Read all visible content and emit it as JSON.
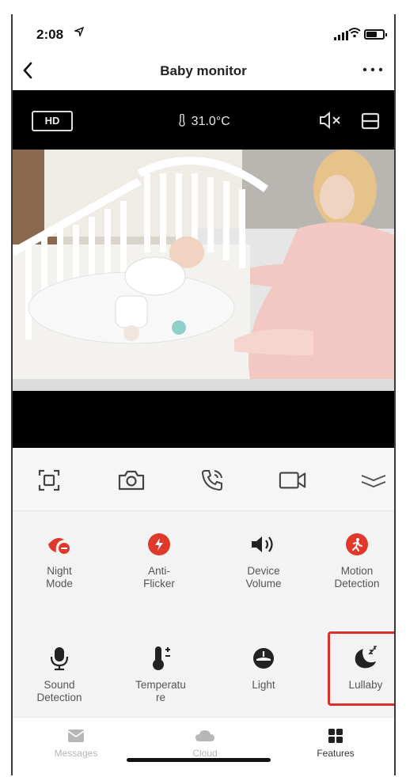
{
  "status_bar": {
    "time": "2:08",
    "location_icon": "location-arrow-icon",
    "signal_icon": "cellular-signal-icon",
    "wifi_icon": "wifi-icon",
    "battery_icon": "battery-icon"
  },
  "nav": {
    "back_icon": "chevron-left-icon",
    "title": "Baby monitor",
    "more_icon": "more-horizontal-icon"
  },
  "video": {
    "quality_label": "HD",
    "temperature": "31.0°C",
    "temperature_icon": "thermometer-icon",
    "mute_icon": "speaker-muted-icon",
    "layout_icon": "layout-icon"
  },
  "toolbar": [
    {
      "name": "screen-fit-icon"
    },
    {
      "name": "snapshot-camera-icon"
    },
    {
      "name": "call-icon"
    },
    {
      "name": "record-video-icon"
    },
    {
      "name": "collapse-chevron-icon"
    }
  ],
  "features": [
    {
      "label_lines": [
        "Night",
        "Mode"
      ],
      "icon": "night-mode-icon",
      "accent": "#e0392b"
    },
    {
      "label_lines": [
        "Anti-",
        "Flicker"
      ],
      "icon": "anti-flicker-icon",
      "accent": "#e0392b"
    },
    {
      "label_lines": [
        "Device",
        "Volume"
      ],
      "icon": "device-volume-icon",
      "accent": "#222222"
    },
    {
      "label_lines": [
        "Motion",
        "Detection"
      ],
      "icon": "motion-detection-icon",
      "accent": "#e0392b"
    },
    {
      "label_lines": [
        "Sound",
        "Detection"
      ],
      "icon": "sound-detection-icon",
      "accent": "#222222"
    },
    {
      "label_lines": [
        "Temperatu",
        "re"
      ],
      "icon": "temperature-icon",
      "accent": "#222222"
    },
    {
      "label_lines": [
        "Light"
      ],
      "icon": "light-icon",
      "accent": "#222222"
    },
    {
      "label_lines": [
        "Lullaby"
      ],
      "icon": "lullaby-icon",
      "accent": "#222222",
      "highlighted": true
    }
  ],
  "tabs": [
    {
      "label": "Messages",
      "icon": "messages-icon",
      "active": false
    },
    {
      "label": "Cloud",
      "icon": "cloud-icon",
      "active": false
    },
    {
      "label": "Features",
      "icon": "features-grid-icon",
      "active": true
    }
  ],
  "colors": {
    "accent_red": "#e0392b",
    "highlight_border": "#d8302a",
    "inactive_tab": "#b7b7b7"
  }
}
